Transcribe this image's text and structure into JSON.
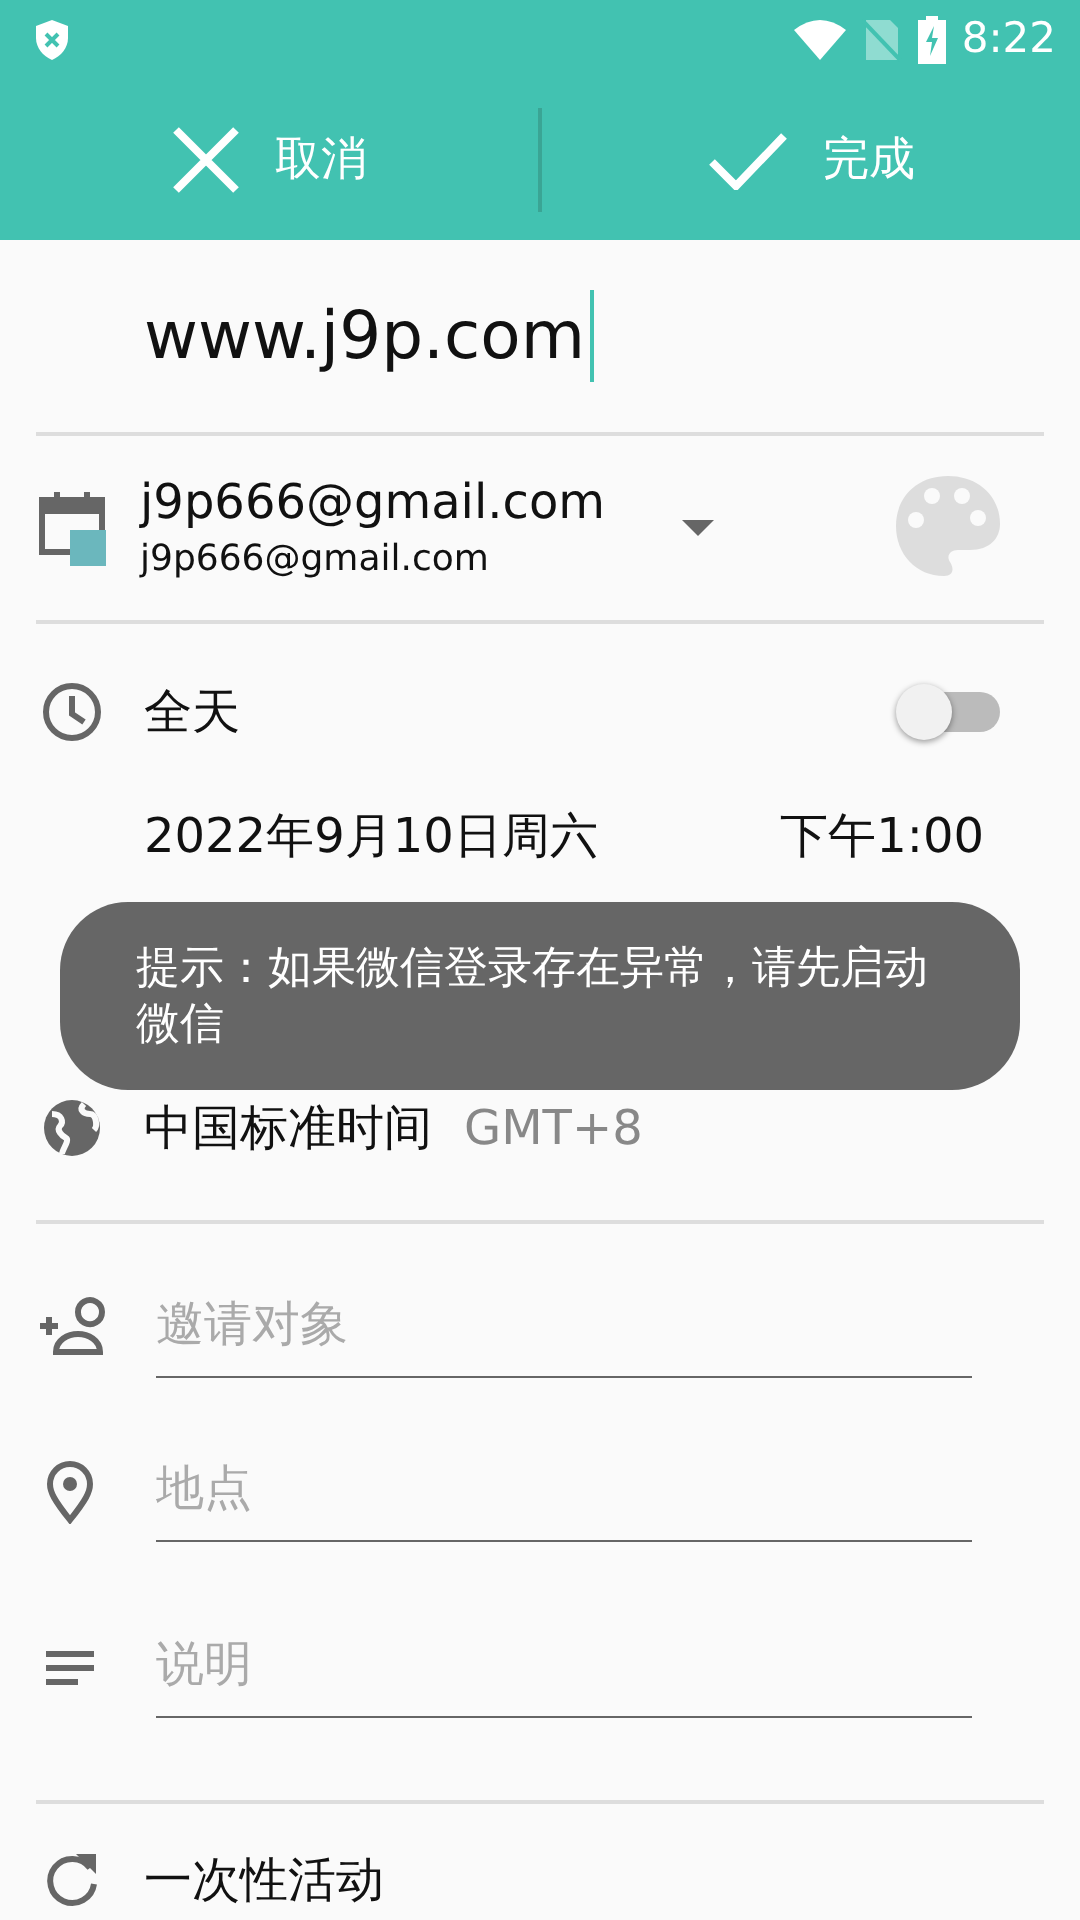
{
  "status_bar": {
    "time": "8:22"
  },
  "toolbar": {
    "buttons": [
      {
        "kind": "cancel",
        "label": "取消"
      },
      {
        "kind": "done",
        "label": "完成"
      }
    ]
  },
  "title": {
    "value": "www.j9p.com"
  },
  "account": {
    "name": "j9p666@gmail.com",
    "email": "j9p666@gmail.com"
  },
  "all_day": {
    "label": "全天",
    "on": false
  },
  "start": {
    "date": "2022年9月10日周六",
    "time": "下午1:00"
  },
  "timezone": {
    "name": "中国标准时间",
    "offset": "GMT+8"
  },
  "fields": [
    {
      "kind": "guests",
      "placeholder": "邀请对象"
    },
    {
      "kind": "location",
      "placeholder": "地点"
    },
    {
      "kind": "description",
      "placeholder": "说明"
    }
  ],
  "repeat": {
    "label": "一次性活动"
  },
  "toast": {
    "text": "提示：如果微信登录存在异常，请先启动微信"
  }
}
